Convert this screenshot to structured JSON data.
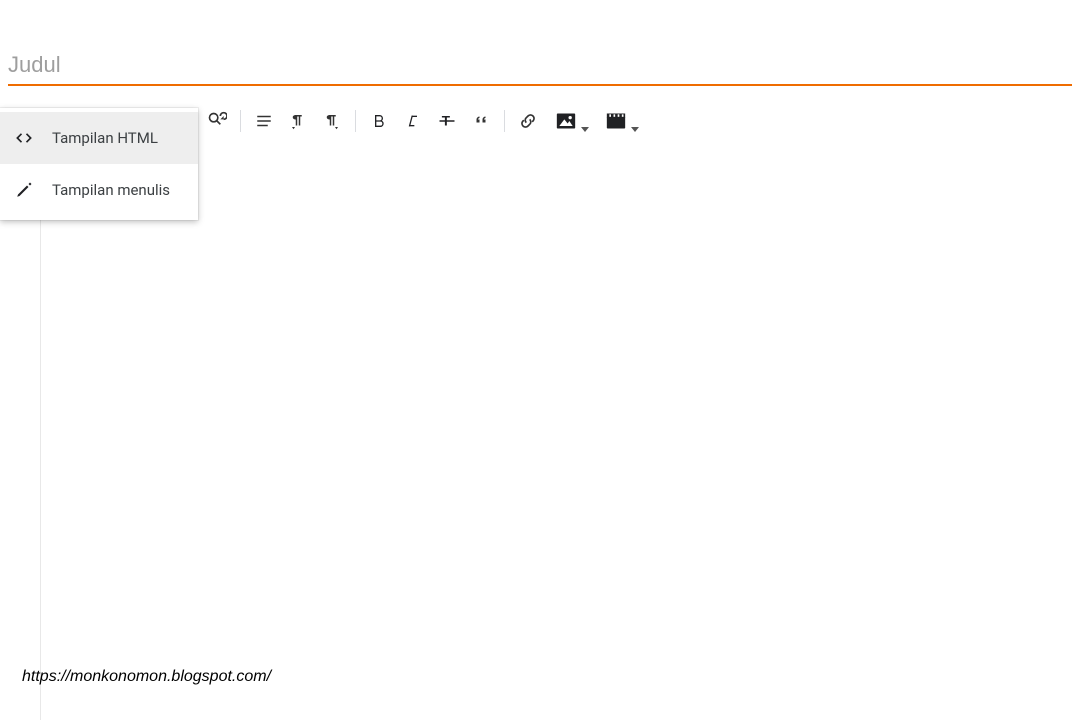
{
  "title": {
    "placeholder": "Judul",
    "value": ""
  },
  "view_menu": {
    "items": [
      {
        "label": "Tampilan HTML",
        "active": true
      },
      {
        "label": "Tampilan menulis",
        "active": false
      }
    ]
  },
  "toolbar": {
    "find_replace": "Find & replace",
    "line_spacing": "Line spacing",
    "ltr": "Left-to-right",
    "rtl": "Right-to-left",
    "bold": "Bold",
    "italic": "Italic",
    "strike": "Strikethrough",
    "quote": "Quote",
    "link": "Insert link",
    "image": "Insert image",
    "video": "Insert video"
  },
  "watermark": "https://monkonomon.blogspot.com/"
}
